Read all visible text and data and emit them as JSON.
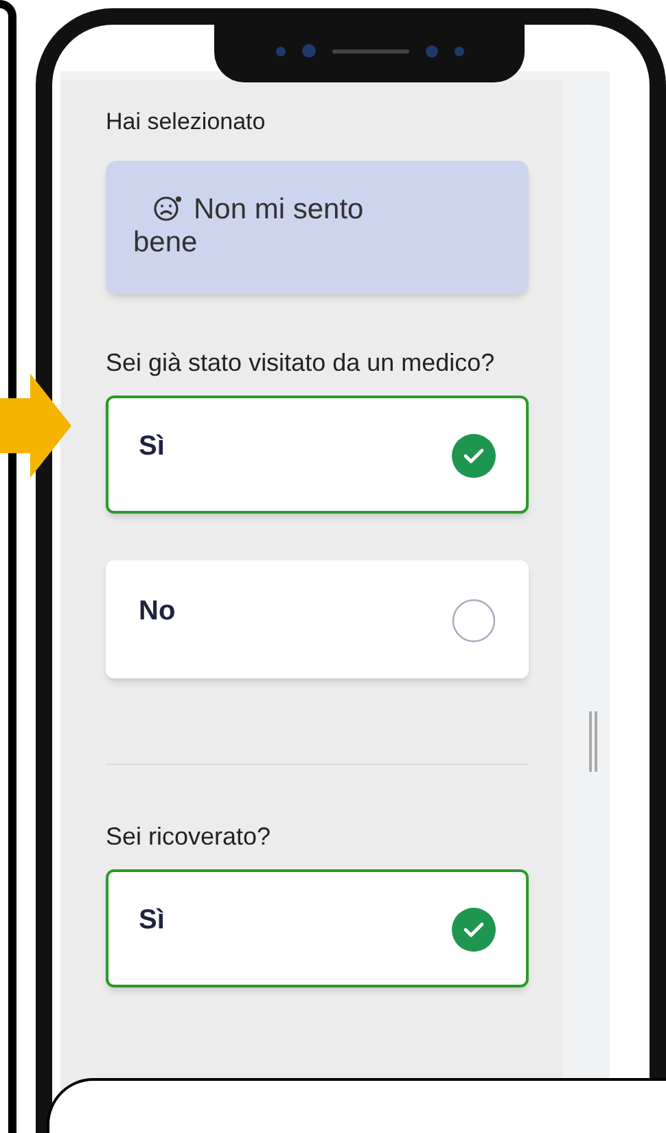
{
  "selection": {
    "heading": "Hai selezionato",
    "value": "Non mi sento bene"
  },
  "questions": [
    {
      "text": "Sei già stato visitato da un medico?",
      "options": [
        {
          "label": "Sì",
          "selected": true
        },
        {
          "label": "No",
          "selected": false
        }
      ]
    },
    {
      "text": "Sei ricoverato?",
      "options": [
        {
          "label": "Sì",
          "selected": true
        }
      ]
    }
  ]
}
